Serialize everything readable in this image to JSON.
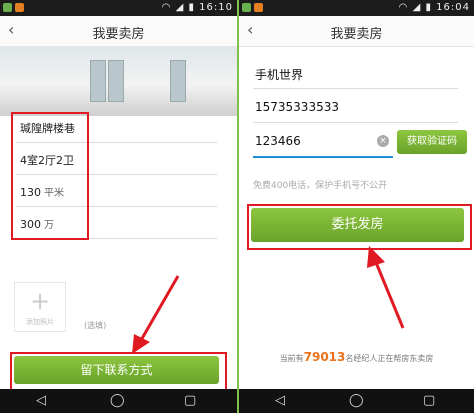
{
  "left": {
    "status": {
      "time": "16:10"
    },
    "header": {
      "title": "我要卖房"
    },
    "fields": {
      "community": "瑊隍牌楼巷",
      "layout": "4室2厅2卫",
      "area_value": "130",
      "area_unit": "平米",
      "price_value": "300",
      "price_unit": "万"
    },
    "photo": {
      "label": "添加照片"
    },
    "optional_label": "(选填)",
    "submit_label": "留下联系方式"
  },
  "right": {
    "status": {
      "time": "16:04"
    },
    "header": {
      "title": "我要卖房"
    },
    "fields": {
      "name": "手机世界",
      "phone": "15735333533",
      "code": "123466"
    },
    "get_code_label": "获取验证码",
    "privacy_text": "免费400电话，保护手机号不公开",
    "submit_label": "委托发房",
    "footer": {
      "prefix": "当前有",
      "count": "79013",
      "suffix": "名经纪人正在帮房东卖房"
    }
  },
  "colors": {
    "accent": "#7ab337",
    "annotation": "#e01a22",
    "count": "#e8731a"
  },
  "icons": [
    "back-chevron-icon",
    "wifi-icon",
    "signal-icon",
    "battery-icon",
    "clear-icon",
    "plus-icon",
    "back-nav-icon",
    "home-nav-icon",
    "recents-nav-icon"
  ]
}
